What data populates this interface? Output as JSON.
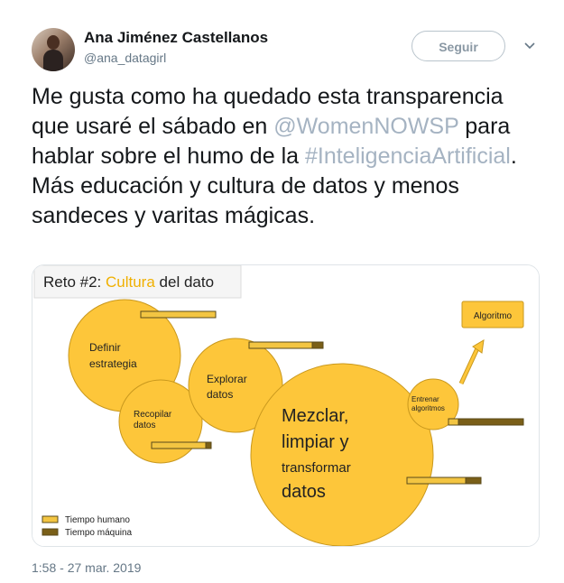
{
  "author": {
    "name": "Ana Jiménez Castellanos",
    "handle": "@ana_datagirl"
  },
  "follow_label": "Seguir",
  "tweet": {
    "t1": "Me gusta como ha quedado esta transparencia que usaré el sábado en ",
    "mention": "@WomenNOWSP",
    "t2": " para hablar sobre el humo de la ",
    "hashtag": "#InteligenciaArtificial",
    "t3": ". Más educación y cultura de datos y menos sandeces y varitas mágicas."
  },
  "slide": {
    "title_prefix": "Reto #2: ",
    "title_highlight": "Cultura",
    "title_suffix": " del dato",
    "circles": {
      "definir_1": "Definir",
      "definir_2": "estrategia",
      "recopilar_1": "Recopilar",
      "recopilar_2": "datos",
      "explorar_1": "Explorar",
      "explorar_2": "datos",
      "mezclar_1": "Mezclar,",
      "mezclar_2": "limpiar y",
      "mezclar_3": "transformar",
      "mezclar_4": "datos",
      "entrenar_1": "Entrenar",
      "entrenar_2": "algoritmos",
      "algoritmo": "Algoritmo"
    },
    "legend": {
      "human": "Tiempo humano",
      "machine": "Tiempo máquina"
    },
    "colors": {
      "yellow": "#fdc63a",
      "human": "#f3c542",
      "machine": "#7a5f18"
    }
  },
  "timestamp": "1:58 - 27 mar. 2019"
}
